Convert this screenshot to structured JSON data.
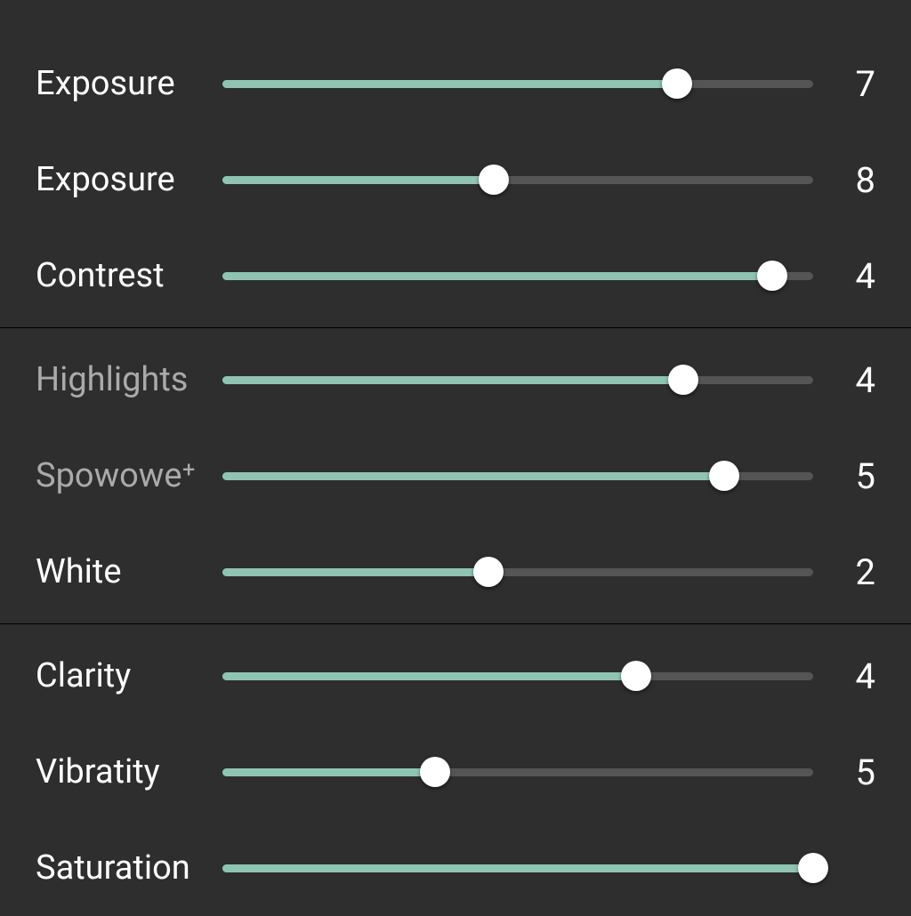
{
  "accent_color": "#8fc4b3",
  "track_color": "#555555",
  "thumb_color": "#ffffff",
  "groups": [
    {
      "sliders": [
        {
          "label": "Exposure",
          "value": 7,
          "fill_pct": 77,
          "muted": false
        },
        {
          "label": "Exposure",
          "value": 8,
          "fill_pct": 46,
          "muted": false
        },
        {
          "label": "Contrest",
          "value": 4,
          "fill_pct": 93,
          "muted": false
        }
      ]
    },
    {
      "sliders": [
        {
          "label": "Highlights",
          "value": 4,
          "fill_pct": 78,
          "muted": true
        },
        {
          "label": "Spowowe⁺",
          "value": 5,
          "fill_pct": 85,
          "muted": true
        },
        {
          "label": "White",
          "value": 2,
          "fill_pct": 45,
          "muted": false
        }
      ]
    },
    {
      "sliders": [
        {
          "label": "Clarity",
          "value": 4,
          "fill_pct": 70,
          "muted": false
        },
        {
          "label": "Vibratity",
          "value": 5,
          "fill_pct": 36,
          "muted": false
        },
        {
          "label": "Saturation",
          "value": "",
          "fill_pct": 100,
          "muted": false,
          "hide_value": true
        }
      ]
    }
  ]
}
